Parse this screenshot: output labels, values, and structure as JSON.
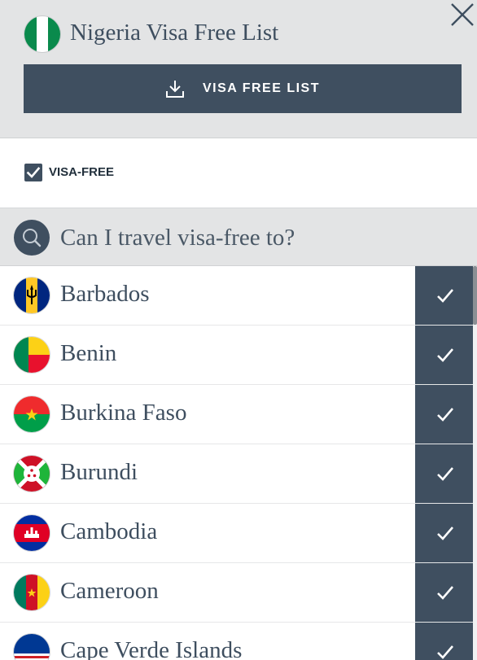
{
  "header": {
    "title": "Nigeria Visa Free List",
    "flag_icon": "nigeria-flag-icon",
    "close_icon": "close-icon",
    "download_button": {
      "label": "VISA FREE LIST",
      "icon": "download-icon"
    }
  },
  "filters": {
    "visa_free": {
      "label": "VISA-FREE",
      "checked": true
    }
  },
  "search": {
    "placeholder": "Can I travel visa-free to?",
    "icon": "search-icon"
  },
  "countries": [
    {
      "name": "Barbados",
      "flag_icon": "barbados-flag-icon",
      "status_icon": "check-icon"
    },
    {
      "name": "Benin",
      "flag_icon": "benin-flag-icon",
      "status_icon": "check-icon"
    },
    {
      "name": "Burkina Faso",
      "flag_icon": "burkina-faso-flag-icon",
      "status_icon": "check-icon"
    },
    {
      "name": "Burundi",
      "flag_icon": "burundi-flag-icon",
      "status_icon": "check-icon"
    },
    {
      "name": "Cambodia",
      "flag_icon": "cambodia-flag-icon",
      "status_icon": "check-icon"
    },
    {
      "name": "Cameroon",
      "flag_icon": "cameroon-flag-icon",
      "status_icon": "check-icon"
    },
    {
      "name": "Cape Verde Islands",
      "flag_icon": "cape-verde-flag-icon",
      "status_icon": "check-icon"
    }
  ],
  "colors": {
    "accent": "#3f4f60",
    "header_bg": "#e3e4e5",
    "text": "#3e4e5f"
  }
}
